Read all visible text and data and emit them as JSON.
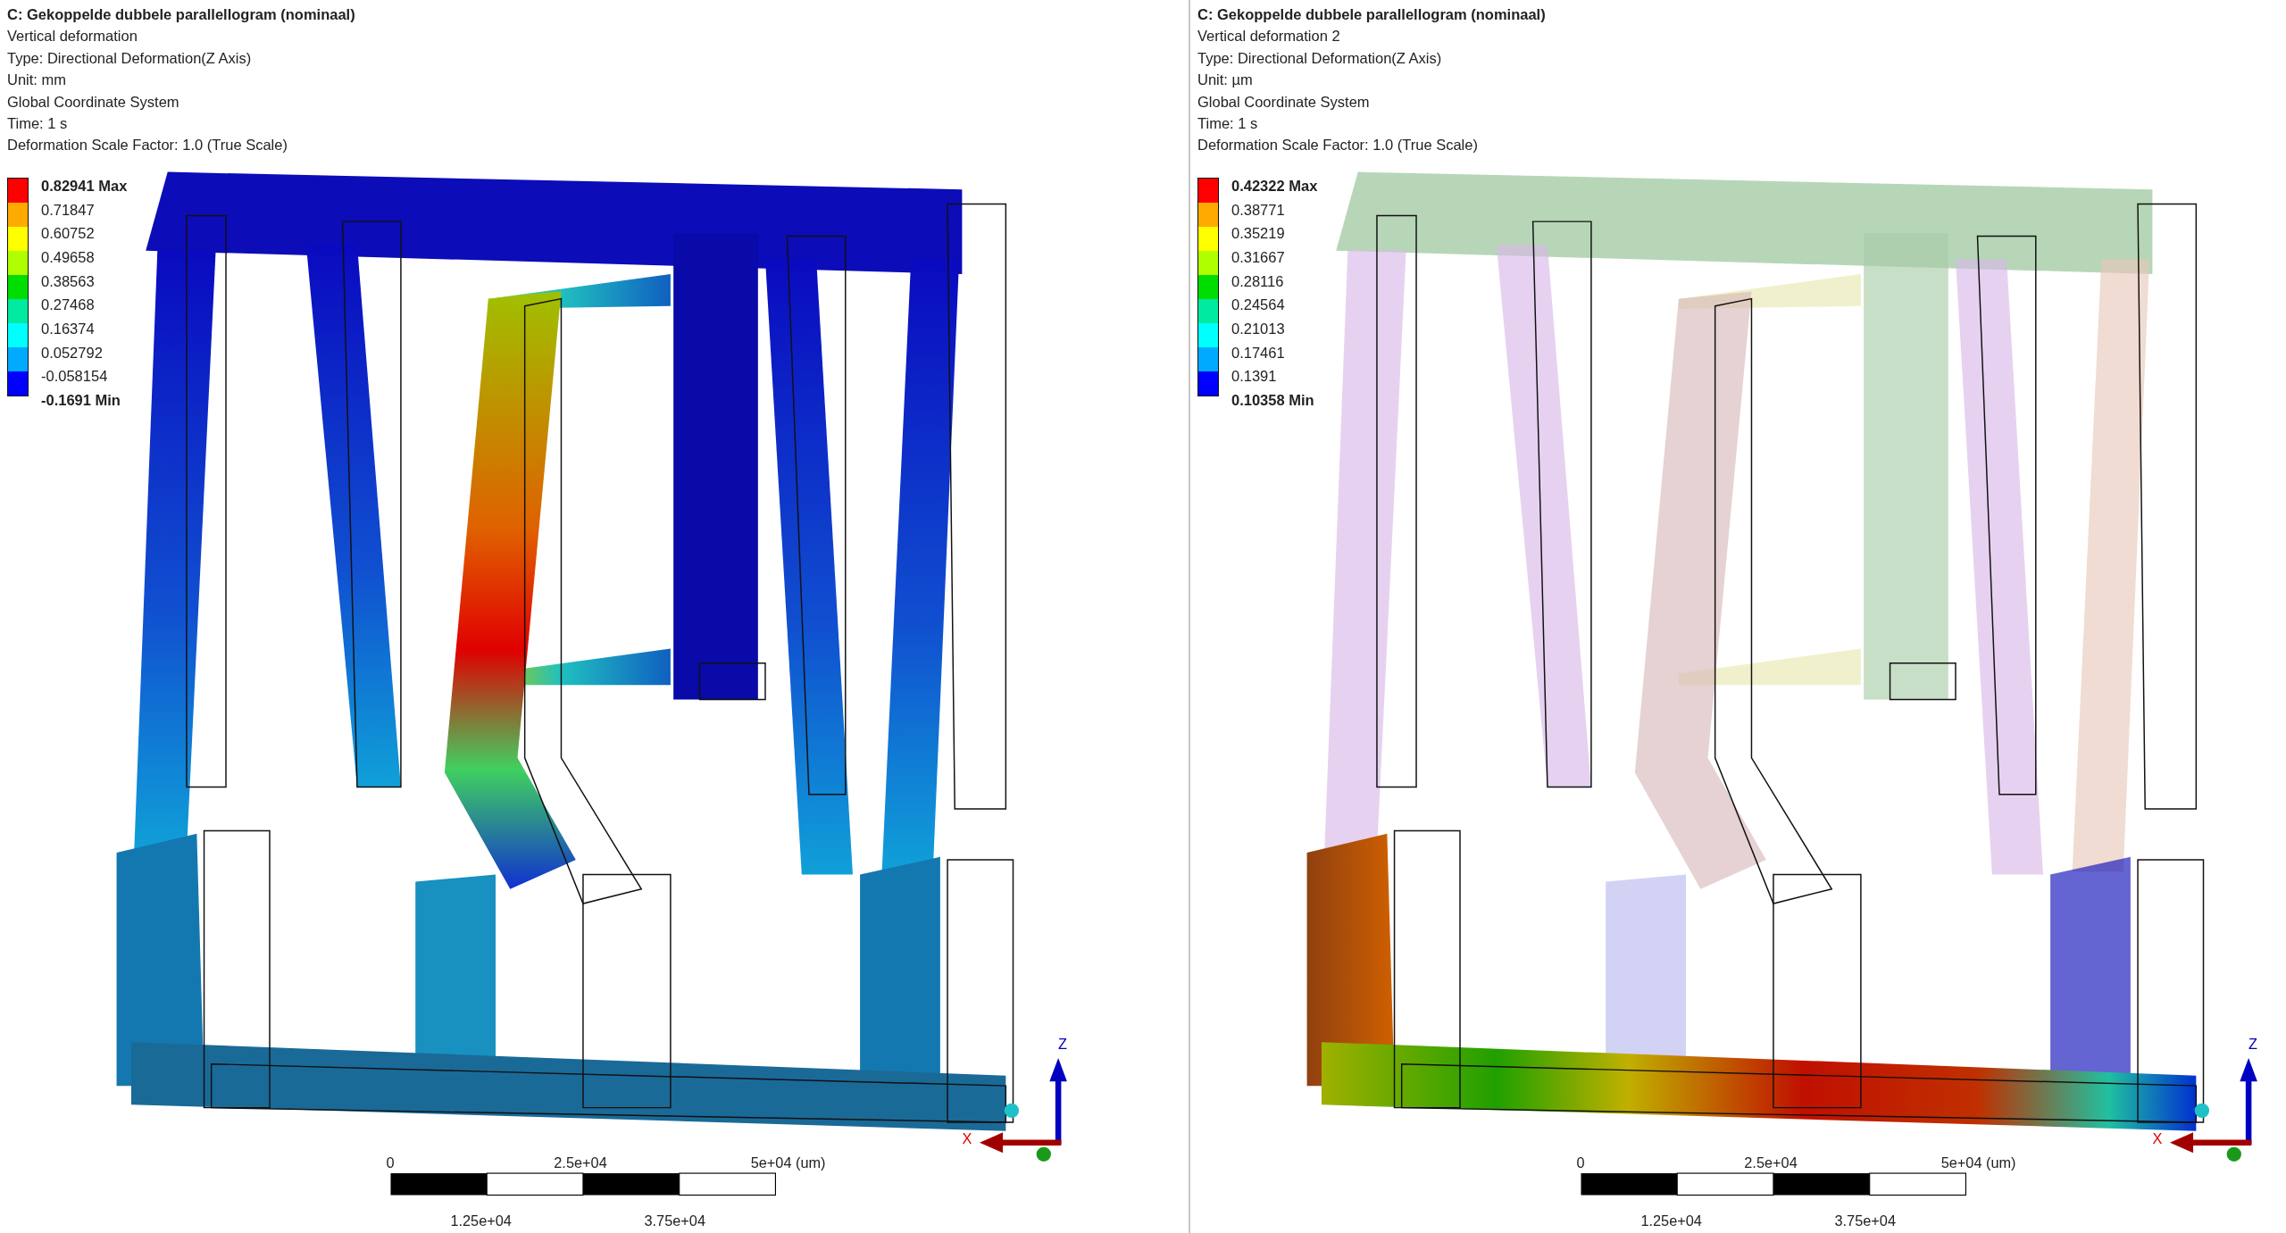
{
  "panels": [
    {
      "kind": "full-contour",
      "title": "C: Gekoppelde dubbele parallellogram (nominaal)",
      "details": [
        "Vertical deformation",
        "Type: Directional Deformation(Z Axis)",
        "Unit: mm",
        "Global Coordinate System",
        "Time: 1 s",
        "Deformation Scale Factor: 1.0 (True Scale)"
      ],
      "legend": {
        "labels": [
          "0.82941 Max",
          "0.71847",
          "0.60752",
          "0.49658",
          "0.38563",
          "0.27468",
          "0.16374",
          "0.052792",
          "-0.058154",
          "-0.1691 Min"
        ],
        "bands": [
          {
            "color": "#ff0000"
          },
          {
            "color": "#ffaa00"
          },
          {
            "color": "#ffff00"
          },
          {
            "color": "#b0ff00"
          },
          {
            "color": "#00dd00"
          },
          {
            "color": "#00eaa0"
          },
          {
            "color": "#00ffff"
          },
          {
            "color": "#00aaff"
          },
          {
            "color": "#0000ff"
          }
        ]
      },
      "scale_bar": {
        "top_labels": [
          "0",
          "2.5e+04",
          "5e+04 (um)"
        ],
        "bottom_labels": [
          "1.25e+04",
          "3.75e+04"
        ]
      },
      "triad": {
        "z_label": "Z",
        "x_label": "X"
      }
    },
    {
      "kind": "bottom-contour",
      "title": "C: Gekoppelde dubbele parallellogram (nominaal)",
      "details": [
        "Vertical deformation 2",
        "Type: Directional Deformation(Z Axis)",
        "Unit: µm",
        "Global Coordinate System",
        "Time: 1 s",
        "Deformation Scale Factor: 1.0 (True Scale)"
      ],
      "legend": {
        "labels": [
          "0.42322 Max",
          "0.38771",
          "0.35219",
          "0.31667",
          "0.28116",
          "0.24564",
          "0.21013",
          "0.17461",
          "0.1391",
          "0.10358 Min"
        ],
        "bands": [
          {
            "color": "#ff0000"
          },
          {
            "color": "#ffaa00"
          },
          {
            "color": "#ffff00"
          },
          {
            "color": "#b0ff00"
          },
          {
            "color": "#00dd00"
          },
          {
            "color": "#00eaa0"
          },
          {
            "color": "#00ffff"
          },
          {
            "color": "#00aaff"
          },
          {
            "color": "#0000ff"
          }
        ]
      },
      "scale_bar": {
        "top_labels": [
          "0",
          "2.5e+04",
          "5e+04 (um)"
        ],
        "bottom_labels": [
          "1.25e+04",
          "3.75e+04"
        ]
      },
      "triad": {
        "z_label": "Z",
        "x_label": "X"
      }
    }
  ]
}
